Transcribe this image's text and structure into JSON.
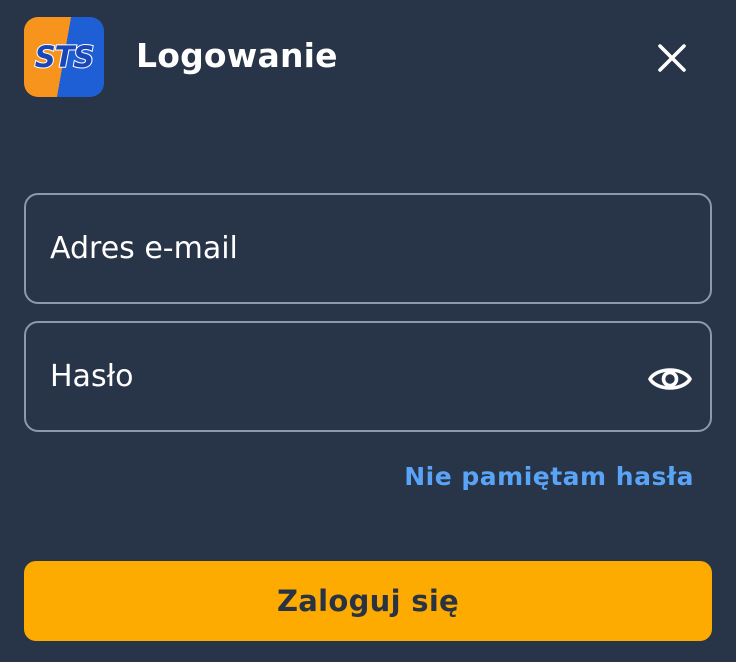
{
  "header": {
    "logo_text": "STS",
    "title": "Logowanie",
    "close_icon": "close-icon"
  },
  "form": {
    "email": {
      "placeholder": "Adres e-mail",
      "value": ""
    },
    "password": {
      "placeholder": "Hasło",
      "value": "",
      "toggle_icon": "eye-icon"
    },
    "forgot_password_label": "Nie pamiętam hasła",
    "submit_label": "Zaloguj się"
  },
  "colors": {
    "background": "#283447",
    "field_border": "#8c98ab",
    "link": "#5aa4f7",
    "primary_button": "#fdab00",
    "primary_button_text": "#2a3344",
    "logo_orange": "#f7941d",
    "logo_blue": "#1f5fd6"
  }
}
